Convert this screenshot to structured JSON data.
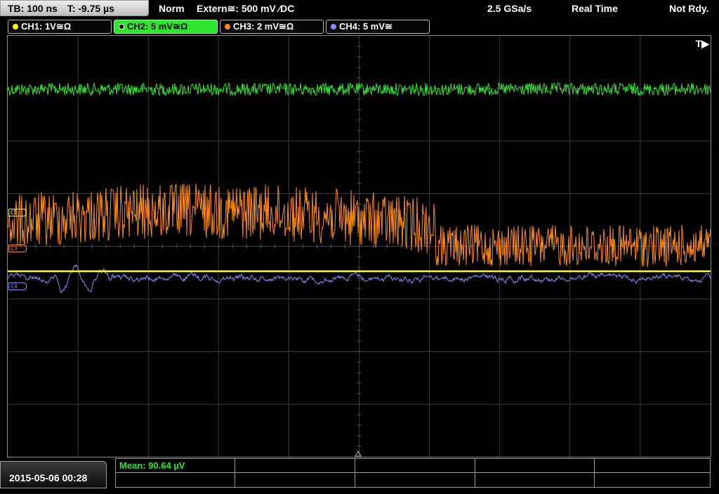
{
  "topbar": {
    "timebase": "TB: 100 ns",
    "trigger_time": "T: -9.75 µs",
    "mode": "Norm",
    "trigger_source": "Extern≅: 500 mV ⁄DC",
    "sample_rate": "2.5 GSa/s",
    "acq_mode": "Real Time",
    "status": "Not Rdy."
  },
  "channels": [
    {
      "label": "CH1: 1V≅Ω",
      "color": "#ffff00"
    },
    {
      "label": "CH2: 5 mV≅Ω",
      "color": "#2ee62e",
      "active": true
    },
    {
      "label": "CH3: 2 mV≅Ω",
      "color": "#ff8c1a"
    },
    {
      "label": "CH4: 5 mV≅",
      "color": "#8c8cff"
    }
  ],
  "markers": {
    "c1": "C1",
    "c3": "C3",
    "c4": "C4"
  },
  "trigger_indicator": "T▶",
  "datetime": "2015-05-06 00:28",
  "measurement": {
    "mean": "Mean: 90.64 µV"
  },
  "colors": {
    "ch1": "#ffff00",
    "ch2": "#2ee62e",
    "ch3": "#ff8c1a",
    "ch4": "#8c8cff",
    "grid": "#3c3c3c"
  }
}
